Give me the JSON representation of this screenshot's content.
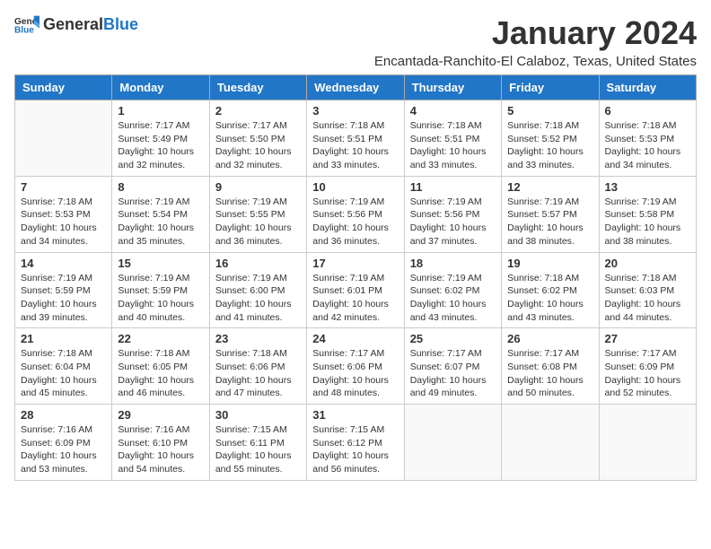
{
  "header": {
    "logo_general": "General",
    "logo_blue": "Blue",
    "title": "January 2024",
    "subtitle": "Encantada-Ranchito-El Calaboz, Texas, United States"
  },
  "days_of_week": [
    "Sunday",
    "Monday",
    "Tuesday",
    "Wednesday",
    "Thursday",
    "Friday",
    "Saturday"
  ],
  "weeks": [
    [
      {
        "day": "",
        "info": ""
      },
      {
        "day": "1",
        "info": "Sunrise: 7:17 AM\nSunset: 5:49 PM\nDaylight: 10 hours\nand 32 minutes."
      },
      {
        "day": "2",
        "info": "Sunrise: 7:17 AM\nSunset: 5:50 PM\nDaylight: 10 hours\nand 32 minutes."
      },
      {
        "day": "3",
        "info": "Sunrise: 7:18 AM\nSunset: 5:51 PM\nDaylight: 10 hours\nand 33 minutes."
      },
      {
        "day": "4",
        "info": "Sunrise: 7:18 AM\nSunset: 5:51 PM\nDaylight: 10 hours\nand 33 minutes."
      },
      {
        "day": "5",
        "info": "Sunrise: 7:18 AM\nSunset: 5:52 PM\nDaylight: 10 hours\nand 33 minutes."
      },
      {
        "day": "6",
        "info": "Sunrise: 7:18 AM\nSunset: 5:53 PM\nDaylight: 10 hours\nand 34 minutes."
      }
    ],
    [
      {
        "day": "7",
        "info": "Sunrise: 7:18 AM\nSunset: 5:53 PM\nDaylight: 10 hours\nand 34 minutes."
      },
      {
        "day": "8",
        "info": "Sunrise: 7:19 AM\nSunset: 5:54 PM\nDaylight: 10 hours\nand 35 minutes."
      },
      {
        "day": "9",
        "info": "Sunrise: 7:19 AM\nSunset: 5:55 PM\nDaylight: 10 hours\nand 36 minutes."
      },
      {
        "day": "10",
        "info": "Sunrise: 7:19 AM\nSunset: 5:56 PM\nDaylight: 10 hours\nand 36 minutes."
      },
      {
        "day": "11",
        "info": "Sunrise: 7:19 AM\nSunset: 5:56 PM\nDaylight: 10 hours\nand 37 minutes."
      },
      {
        "day": "12",
        "info": "Sunrise: 7:19 AM\nSunset: 5:57 PM\nDaylight: 10 hours\nand 38 minutes."
      },
      {
        "day": "13",
        "info": "Sunrise: 7:19 AM\nSunset: 5:58 PM\nDaylight: 10 hours\nand 38 minutes."
      }
    ],
    [
      {
        "day": "14",
        "info": "Sunrise: 7:19 AM\nSunset: 5:59 PM\nDaylight: 10 hours\nand 39 minutes."
      },
      {
        "day": "15",
        "info": "Sunrise: 7:19 AM\nSunset: 5:59 PM\nDaylight: 10 hours\nand 40 minutes."
      },
      {
        "day": "16",
        "info": "Sunrise: 7:19 AM\nSunset: 6:00 PM\nDaylight: 10 hours\nand 41 minutes."
      },
      {
        "day": "17",
        "info": "Sunrise: 7:19 AM\nSunset: 6:01 PM\nDaylight: 10 hours\nand 42 minutes."
      },
      {
        "day": "18",
        "info": "Sunrise: 7:19 AM\nSunset: 6:02 PM\nDaylight: 10 hours\nand 43 minutes."
      },
      {
        "day": "19",
        "info": "Sunrise: 7:18 AM\nSunset: 6:02 PM\nDaylight: 10 hours\nand 43 minutes."
      },
      {
        "day": "20",
        "info": "Sunrise: 7:18 AM\nSunset: 6:03 PM\nDaylight: 10 hours\nand 44 minutes."
      }
    ],
    [
      {
        "day": "21",
        "info": "Sunrise: 7:18 AM\nSunset: 6:04 PM\nDaylight: 10 hours\nand 45 minutes."
      },
      {
        "day": "22",
        "info": "Sunrise: 7:18 AM\nSunset: 6:05 PM\nDaylight: 10 hours\nand 46 minutes."
      },
      {
        "day": "23",
        "info": "Sunrise: 7:18 AM\nSunset: 6:06 PM\nDaylight: 10 hours\nand 47 minutes."
      },
      {
        "day": "24",
        "info": "Sunrise: 7:17 AM\nSunset: 6:06 PM\nDaylight: 10 hours\nand 48 minutes."
      },
      {
        "day": "25",
        "info": "Sunrise: 7:17 AM\nSunset: 6:07 PM\nDaylight: 10 hours\nand 49 minutes."
      },
      {
        "day": "26",
        "info": "Sunrise: 7:17 AM\nSunset: 6:08 PM\nDaylight: 10 hours\nand 50 minutes."
      },
      {
        "day": "27",
        "info": "Sunrise: 7:17 AM\nSunset: 6:09 PM\nDaylight: 10 hours\nand 52 minutes."
      }
    ],
    [
      {
        "day": "28",
        "info": "Sunrise: 7:16 AM\nSunset: 6:09 PM\nDaylight: 10 hours\nand 53 minutes."
      },
      {
        "day": "29",
        "info": "Sunrise: 7:16 AM\nSunset: 6:10 PM\nDaylight: 10 hours\nand 54 minutes."
      },
      {
        "day": "30",
        "info": "Sunrise: 7:15 AM\nSunset: 6:11 PM\nDaylight: 10 hours\nand 55 minutes."
      },
      {
        "day": "31",
        "info": "Sunrise: 7:15 AM\nSunset: 6:12 PM\nDaylight: 10 hours\nand 56 minutes."
      },
      {
        "day": "",
        "info": ""
      },
      {
        "day": "",
        "info": ""
      },
      {
        "day": "",
        "info": ""
      }
    ]
  ]
}
